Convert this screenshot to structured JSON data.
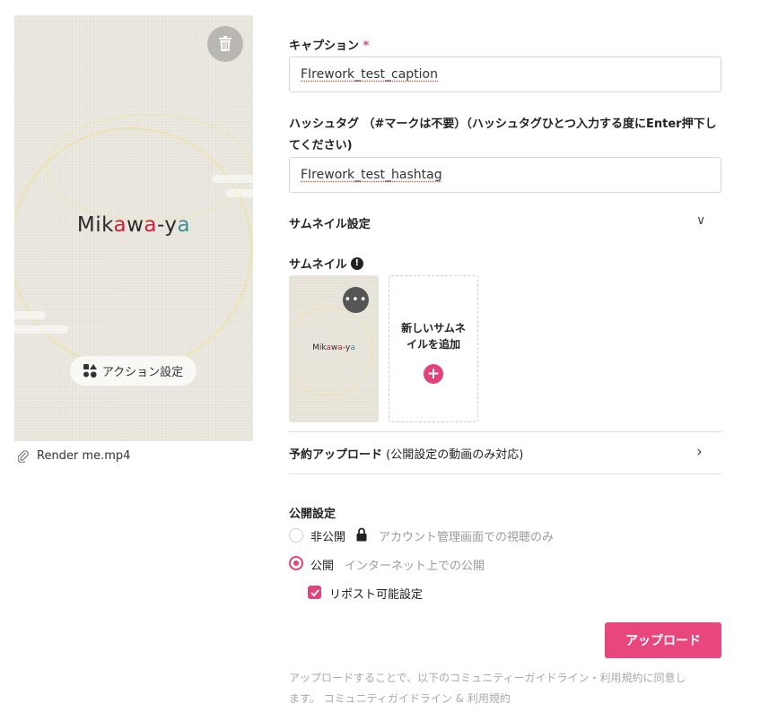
{
  "preview": {
    "logo_parts": [
      "Mik",
      "a",
      "w",
      "a",
      "-y",
      "a"
    ],
    "action_label": "アクション設定",
    "file_name": "Render me.mp4"
  },
  "form": {
    "caption": {
      "label": "キャプション",
      "required_mark": "*",
      "value": "FIrework_test_caption"
    },
    "hashtag": {
      "label_line1": "ハッシュタグ （#マークは不要）（ハッシュタグひとつ入力する度にEnter押下し",
      "label_line2": "てください)",
      "value": "FIrework_test_hashtag"
    },
    "thumbnail_settings": {
      "label": "サムネイル設定",
      "chevron": "∨"
    },
    "thumbnail": {
      "label": "サムネイル",
      "info": "!",
      "menu": "•••",
      "add_line1": "新しいサムネ",
      "add_line2": "イルを追加",
      "add_icon": "+"
    },
    "scheduled_upload": {
      "label_main": "予約アップロード",
      "label_note": " (公開設定の動画のみ対応)",
      "chevron": "›"
    },
    "visibility": {
      "label": "公開設定",
      "private_label": "非公開",
      "private_desc": "アカウント管理画面での視聴のみ",
      "public_label": "公開",
      "public_desc": "インターネット上での公開",
      "selected": "public",
      "repost_label": "リポスト可能設定",
      "repost_checked": true
    },
    "upload_button": "アップロード",
    "footnote_line1": "アップロードすることで、以下のコミュニティーガイドライン・利用規約に同意し",
    "footnote_line2": "ます。 コミュニティガイドライン & 利用規約"
  },
  "colors": {
    "accent": "#e8477e",
    "logo_red": "#c7243a",
    "logo_teal": "#3f8f96"
  }
}
